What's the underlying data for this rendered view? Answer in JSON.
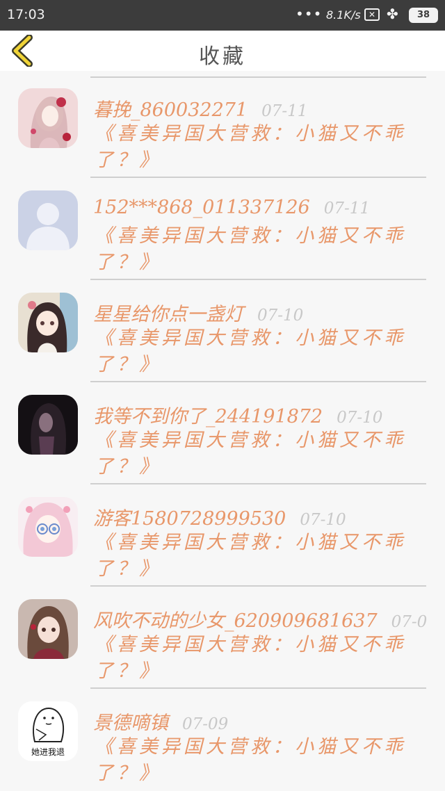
{
  "status_bar": {
    "time": "17:03",
    "signal_dots": "•••",
    "net_speed": "8.1K/s",
    "battery": "38"
  },
  "header": {
    "title": "收藏",
    "back_icon": "chevron-left-icon",
    "accent": "#f0d437"
  },
  "colors": {
    "name": "#e8976a",
    "date": "#c8c8c8",
    "divider": "#cfcfcf",
    "background": "#f7f7f7"
  },
  "items": [
    {
      "name": "暮挽_860032271",
      "date": "07-11",
      "content": "《喜美异国大营救：小猫又不乖了？》",
      "avatar": "girl-flowers-avatar"
    },
    {
      "name": "152***868_011337126",
      "date": "07-11",
      "content": "《喜美异国大营救：小猫又不乖了？》",
      "avatar": "default-user-avatar"
    },
    {
      "name": "星星给你点一盏灯",
      "date": "07-10",
      "content": "《喜美异国大营救：小猫又不乖了？》",
      "avatar": "anime-girl-avatar"
    },
    {
      "name": "我等不到你了_244191872",
      "date": "07-10",
      "content": "《喜美异国大营救：小猫又不乖了？》",
      "avatar": "dark-girl-avatar"
    },
    {
      "name": "游客1580728999530",
      "date": "07-10",
      "content": "《喜美异国大营救：小猫又不乖了？》",
      "avatar": "pink-anime-avatar"
    },
    {
      "name": "风吹不动的少女_620909681637",
      "date": "07-0",
      "content": "《喜美异国大营救：小猫又不乖了？》",
      "avatar": "brown-hair-girl-avatar"
    },
    {
      "name": "景德嘀镇",
      "date": "07-09",
      "content": "《喜美异国大营救：小猫又不乖了？》",
      "avatar": "meme-sticker-avatar",
      "avatar_text": "她进我退"
    }
  ]
}
